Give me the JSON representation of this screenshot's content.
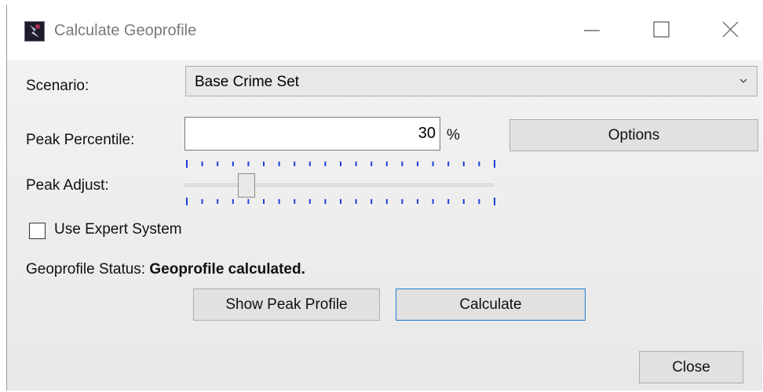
{
  "window": {
    "title": "Calculate Geoprofile",
    "icon": "geoprofile-app-icon",
    "controls": [
      "minimize-icon",
      "maximize-icon",
      "close-icon"
    ]
  },
  "form": {
    "scenario": {
      "label": "Scenario:",
      "selected": "Base Crime Set"
    },
    "peak_percentile": {
      "label": "Peak Percentile:",
      "value": "30",
      "unit": "%"
    },
    "options_button": "Options",
    "peak_adjust": {
      "label": "Peak Adjust:",
      "slider_fraction": 0.18
    },
    "expert_system": {
      "label": "Use Expert System",
      "checked": false
    },
    "status": {
      "label": "Geoprofile Status:",
      "value": "Geoprofile calculated."
    },
    "show_peak_profile_button": "Show Peak Profile",
    "calculate_button": "Calculate",
    "close_button": "Close"
  },
  "colors": {
    "primary_border": "#1c7dd4",
    "tick_marks": "#1e3fd8"
  }
}
